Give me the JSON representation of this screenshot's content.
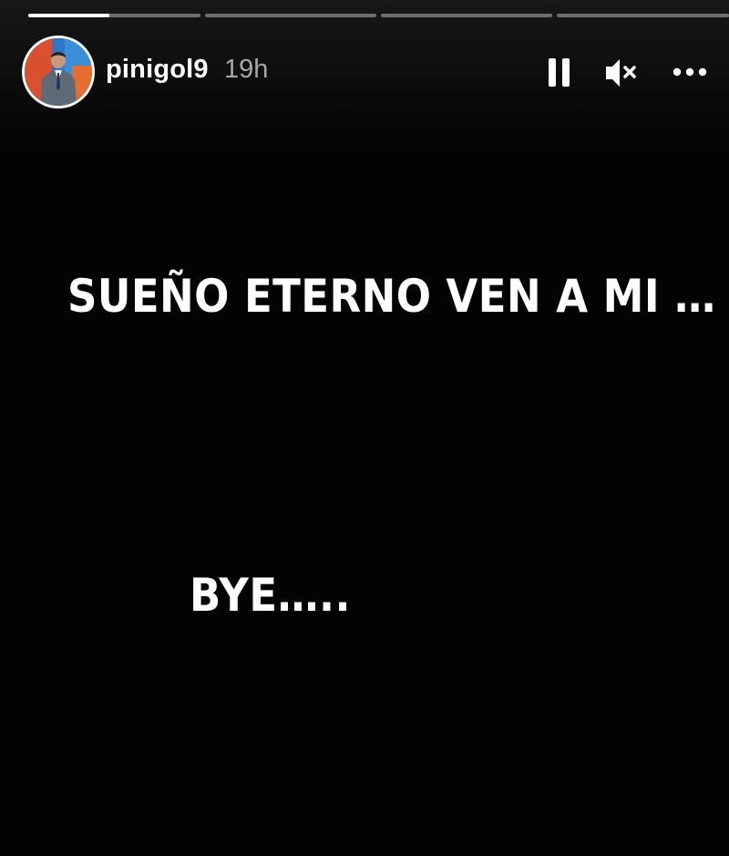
{
  "story": {
    "username": "pinigol9",
    "time_ago": "19h",
    "segments": [
      {
        "progress": 0.47
      },
      {
        "progress": 0
      },
      {
        "progress": 0
      },
      {
        "progress": 0
      }
    ],
    "lines": [
      "SUEÑO ETERNO VEN A MI …",
      "BYE….."
    ]
  },
  "icons": {
    "pause": "pause-icon",
    "mute": "speaker-muted-icon",
    "more": "more-options-icon"
  },
  "colors": {
    "background": "#030303",
    "text": "#ffffff",
    "muted_text": "#a8a8a8"
  }
}
